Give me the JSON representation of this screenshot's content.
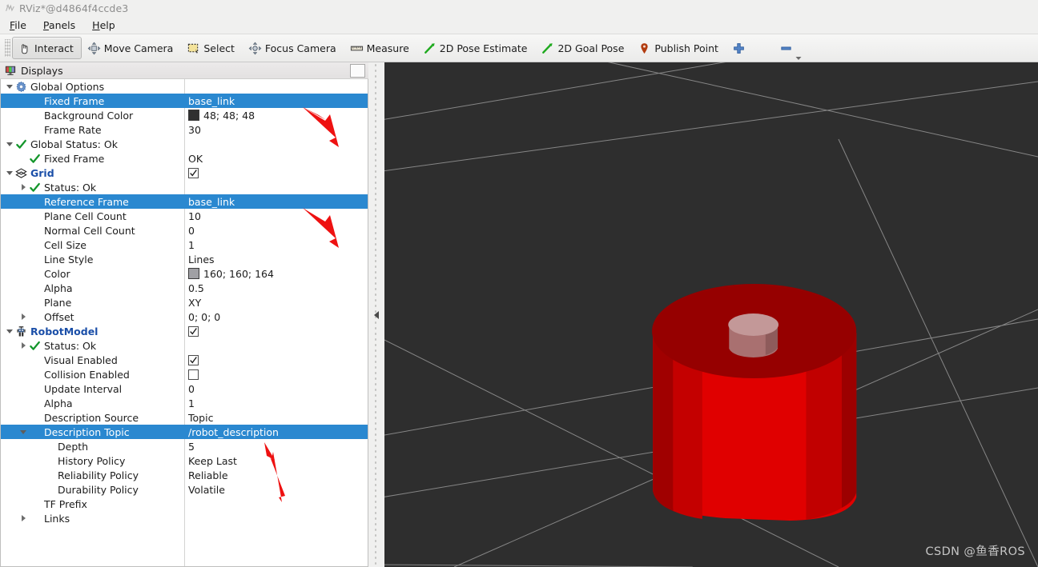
{
  "window": {
    "title": "RViz*@d4864f4ccde3",
    "icon": "rviz-app-icon"
  },
  "menubar": {
    "items": [
      {
        "label": "File",
        "accel": "F"
      },
      {
        "label": "Panels",
        "accel": "P"
      },
      {
        "label": "Help",
        "accel": "H"
      }
    ]
  },
  "toolbar": {
    "items": [
      {
        "label": "Interact",
        "icon": "hand-cursor-icon",
        "active": true
      },
      {
        "label": "Move Camera",
        "icon": "move-camera-icon",
        "active": false
      },
      {
        "label": "Select",
        "icon": "select-box-icon",
        "active": false
      },
      {
        "label": "Focus Camera",
        "icon": "focus-camera-icon",
        "active": false
      },
      {
        "label": "Measure",
        "icon": "ruler-icon",
        "active": false
      },
      {
        "label": "2D Pose Estimate",
        "icon": "pose-arrow-icon",
        "active": false
      },
      {
        "label": "2D Goal Pose",
        "icon": "goal-arrow-icon",
        "active": false
      },
      {
        "label": "Publish Point",
        "icon": "map-pin-icon",
        "active": false
      }
    ],
    "add_tool_icon": "plus-icon",
    "remove_tool_icon": "minus-icon",
    "overflow_icon": "chevron-down-icon"
  },
  "displays_panel": {
    "title": "Displays",
    "icon": "displays-panel-icon",
    "header_checkbox_checked": false,
    "rows": [
      {
        "indent": 0,
        "expander": "down",
        "icon": "gear-icon",
        "label": "Global Options",
        "value": "",
        "value_type": "none",
        "selected": false,
        "bold": false
      },
      {
        "indent": 1,
        "expander": "none",
        "icon": "none",
        "label": "Fixed Frame",
        "value": "base_link",
        "value_type": "text",
        "selected": true,
        "bold": false
      },
      {
        "indent": 1,
        "expander": "none",
        "icon": "none",
        "label": "Background Color",
        "value": "48; 48; 48",
        "value_type": "color",
        "swatch": "#303030",
        "selected": false,
        "bold": false
      },
      {
        "indent": 1,
        "expander": "none",
        "icon": "none",
        "label": "Frame Rate",
        "value": "30",
        "value_type": "text",
        "selected": false,
        "bold": false
      },
      {
        "indent": 0,
        "expander": "down",
        "icon": "check-icon",
        "label": "Global Status: Ok",
        "value": "",
        "value_type": "none",
        "selected": false,
        "bold": false
      },
      {
        "indent": 1,
        "expander": "none",
        "icon": "check-icon",
        "label": "Fixed Frame",
        "value": "OK",
        "value_type": "text",
        "selected": false,
        "bold": false
      },
      {
        "indent": 0,
        "expander": "down",
        "icon": "grid-layers-icon",
        "label": "Grid",
        "value": "",
        "value_type": "checkbox",
        "checked": true,
        "selected": false,
        "bold": true
      },
      {
        "indent": 1,
        "expander": "right",
        "icon": "check-icon",
        "label": "Status: Ok",
        "value": "",
        "value_type": "none",
        "selected": false,
        "bold": false
      },
      {
        "indent": 1,
        "expander": "none",
        "icon": "none",
        "label": "Reference Frame",
        "value": "base_link",
        "value_type": "text",
        "selected": true,
        "bold": false
      },
      {
        "indent": 1,
        "expander": "none",
        "icon": "none",
        "label": "Plane Cell Count",
        "value": "10",
        "value_type": "text",
        "selected": false,
        "bold": false
      },
      {
        "indent": 1,
        "expander": "none",
        "icon": "none",
        "label": "Normal Cell Count",
        "value": "0",
        "value_type": "text",
        "selected": false,
        "bold": false
      },
      {
        "indent": 1,
        "expander": "none",
        "icon": "none",
        "label": "Cell Size",
        "value": "1",
        "value_type": "text",
        "selected": false,
        "bold": false
      },
      {
        "indent": 1,
        "expander": "none",
        "icon": "none",
        "label": "Line Style",
        "value": "Lines",
        "value_type": "text",
        "selected": false,
        "bold": false
      },
      {
        "indent": 1,
        "expander": "none",
        "icon": "none",
        "label": "Color",
        "value": "160; 160; 164",
        "value_type": "color",
        "swatch": "#a0a0a4",
        "selected": false,
        "bold": false
      },
      {
        "indent": 1,
        "expander": "none",
        "icon": "none",
        "label": "Alpha",
        "value": "0.5",
        "value_type": "text",
        "selected": false,
        "bold": false
      },
      {
        "indent": 1,
        "expander": "none",
        "icon": "none",
        "label": "Plane",
        "value": "XY",
        "value_type": "text",
        "selected": false,
        "bold": false
      },
      {
        "indent": 1,
        "expander": "right",
        "icon": "none",
        "label": "Offset",
        "value": "0; 0; 0",
        "value_type": "text",
        "selected": false,
        "bold": false
      },
      {
        "indent": 0,
        "expander": "down",
        "icon": "robot-icon",
        "label": "RobotModel",
        "value": "",
        "value_type": "checkbox",
        "checked": true,
        "selected": false,
        "bold": true
      },
      {
        "indent": 1,
        "expander": "right",
        "icon": "check-icon",
        "label": "Status: Ok",
        "value": "",
        "value_type": "none",
        "selected": false,
        "bold": false
      },
      {
        "indent": 1,
        "expander": "none",
        "icon": "none",
        "label": "Visual Enabled",
        "value": "",
        "value_type": "checkbox",
        "checked": true,
        "selected": false,
        "bold": false
      },
      {
        "indent": 1,
        "expander": "none",
        "icon": "none",
        "label": "Collision Enabled",
        "value": "",
        "value_type": "checkbox",
        "checked": false,
        "selected": false,
        "bold": false
      },
      {
        "indent": 1,
        "expander": "none",
        "icon": "none",
        "label": "Update Interval",
        "value": "0",
        "value_type": "text",
        "selected": false,
        "bold": false
      },
      {
        "indent": 1,
        "expander": "none",
        "icon": "none",
        "label": "Alpha",
        "value": "1",
        "value_type": "text",
        "selected": false,
        "bold": false
      },
      {
        "indent": 1,
        "expander": "none",
        "icon": "none",
        "label": "Description Source",
        "value": "Topic",
        "value_type": "text",
        "selected": false,
        "bold": false
      },
      {
        "indent": 1,
        "expander": "down",
        "icon": "none",
        "label": "Description Topic",
        "value": "/robot_description",
        "value_type": "text",
        "selected": true,
        "bold": false
      },
      {
        "indent": 2,
        "expander": "none",
        "icon": "none",
        "label": "Depth",
        "value": "5",
        "value_type": "text",
        "selected": false,
        "bold": false
      },
      {
        "indent": 2,
        "expander": "none",
        "icon": "none",
        "label": "History Policy",
        "value": "Keep Last",
        "value_type": "text",
        "selected": false,
        "bold": false
      },
      {
        "indent": 2,
        "expander": "none",
        "icon": "none",
        "label": "Reliability Policy",
        "value": "Reliable",
        "value_type": "text",
        "selected": false,
        "bold": false
      },
      {
        "indent": 2,
        "expander": "none",
        "icon": "none",
        "label": "Durability Policy",
        "value": "Volatile",
        "value_type": "text",
        "selected": false,
        "bold": false
      },
      {
        "indent": 1,
        "expander": "none",
        "icon": "none",
        "label": "TF Prefix",
        "value": "",
        "value_type": "text",
        "selected": false,
        "bold": false
      },
      {
        "indent": 1,
        "expander": "right",
        "icon": "none",
        "label": "Links",
        "value": "",
        "value_type": "none",
        "selected": false,
        "bold": false
      }
    ]
  },
  "viewport": {
    "background_color": "#2e2e2e",
    "grid_line_color": "#9c9c9c",
    "robot": {
      "body_color": "#e00000",
      "body_top_color": "#960000",
      "body_side_dark": "#a50000",
      "knob_color": "#b07878",
      "knob_top_color": "#c09090"
    },
    "watermark": "CSDN @鱼香ROS"
  },
  "annotations": {
    "arrow_color": "#ee1111",
    "arrows": [
      {
        "name": "arrow-fixed-frame"
      },
      {
        "name": "arrow-reference-frame"
      },
      {
        "name": "arrow-description-topic"
      }
    ]
  }
}
